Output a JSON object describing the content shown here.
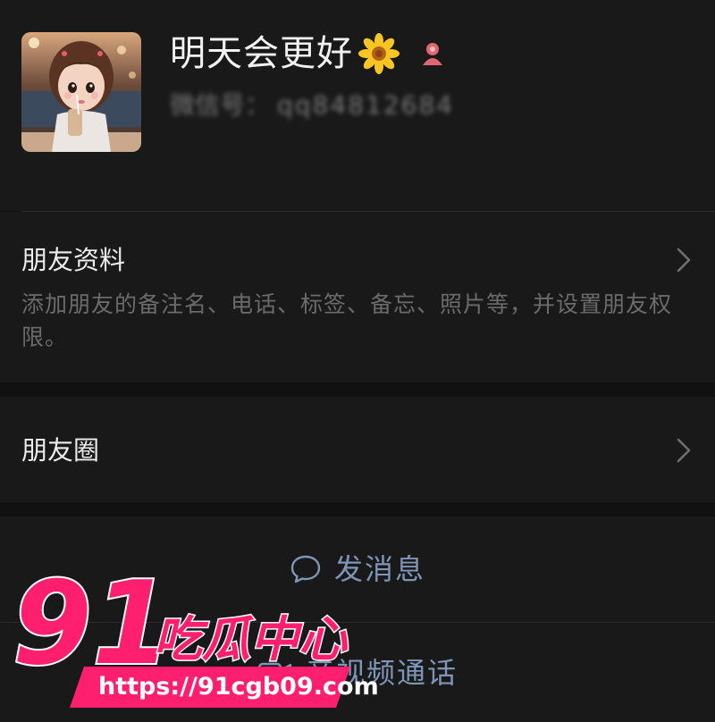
{
  "profile": {
    "nickname": "明天会更好",
    "nickname_emoji": "sunflower-icon",
    "gender": "female",
    "wechat_id_label": "微信号：",
    "wechat_id_value": "qq84812684"
  },
  "friend_profile": {
    "title": "朋友资料",
    "description": "添加朋友的备注名、电话、标签、备忘、照片等，并设置朋友权限。"
  },
  "moments": {
    "title": "朋友圈"
  },
  "actions": {
    "message_label": "发消息",
    "video_call_label": "音视频通话"
  },
  "watermark": {
    "brand_number": "91",
    "brand_text": "吃瓜中心",
    "url": "https://91cgb09.com"
  },
  "colors": {
    "background": "#111111",
    "cell": "#191919",
    "action_text": "#7e95b8",
    "watermark": "#ff1f6e"
  }
}
